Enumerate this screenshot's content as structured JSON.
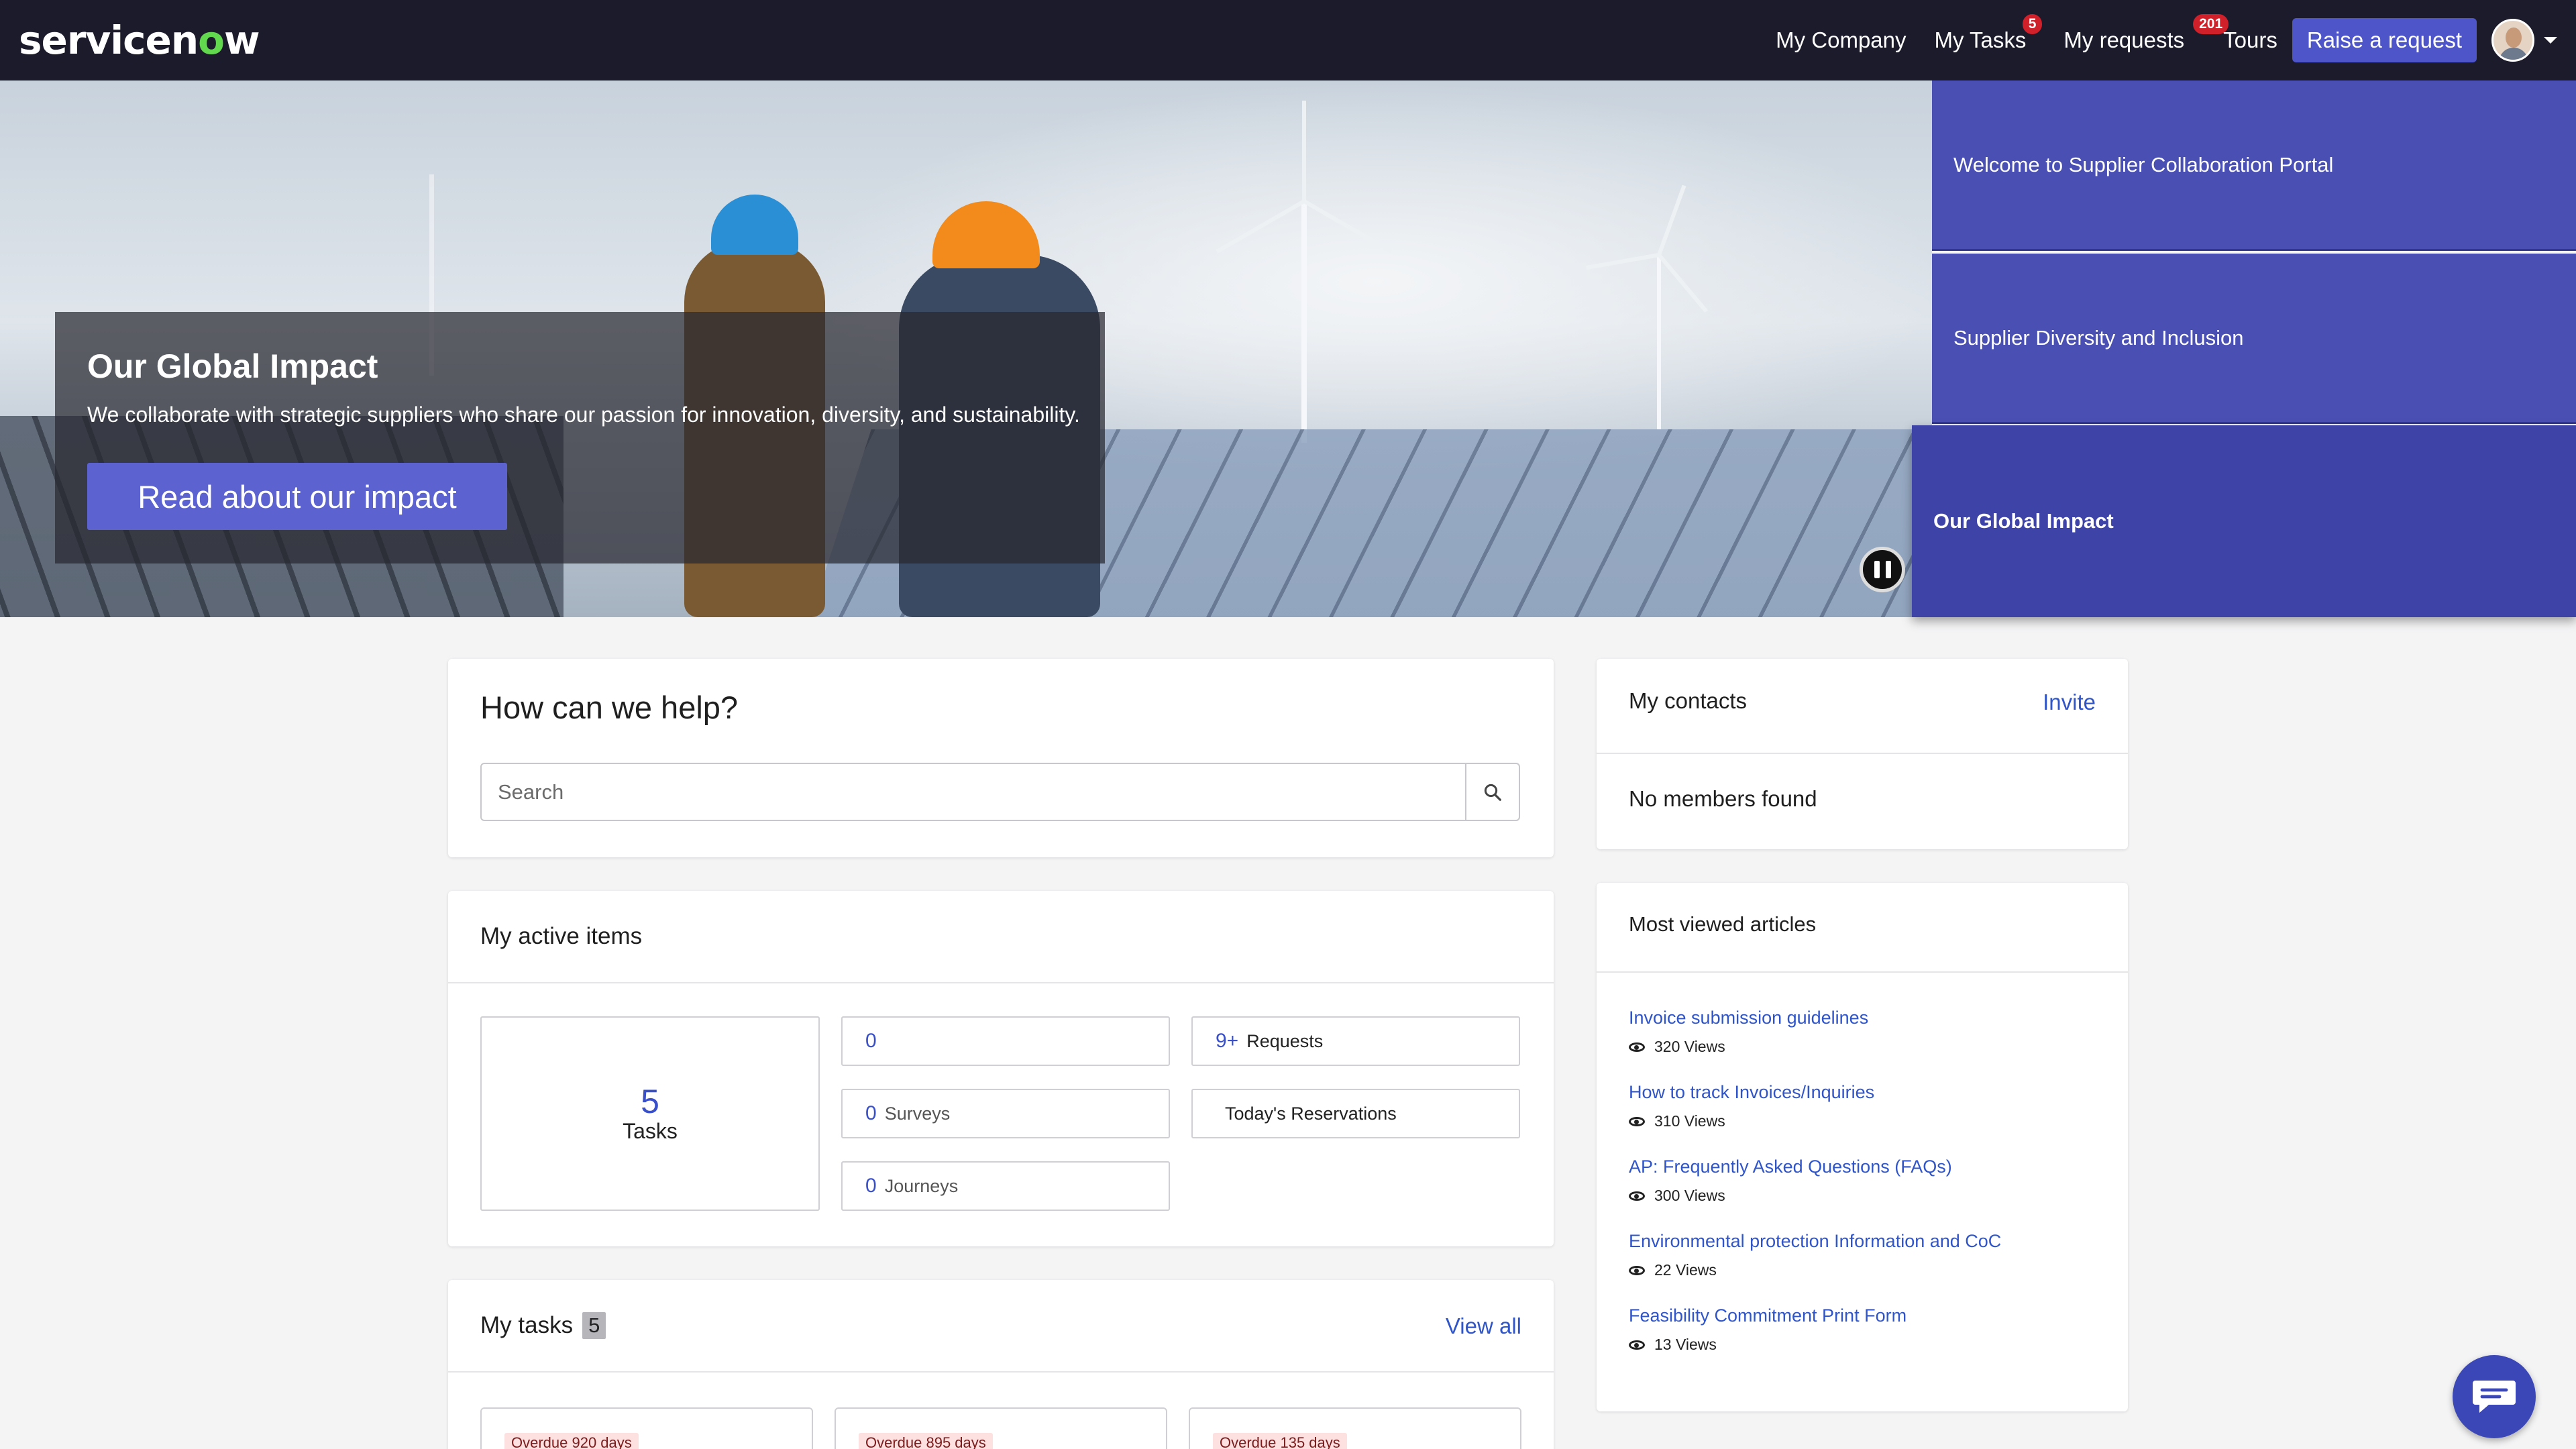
{
  "brand": {
    "logo_main": "servicen",
    "logo_o": "o",
    "logo_end": "w"
  },
  "nav": {
    "my_company": "My Company",
    "my_tasks": "My Tasks",
    "my_tasks_badge": "5",
    "my_requests": "My requests",
    "my_requests_badge": "201",
    "tours": "Tours",
    "raise_request": "Raise a request"
  },
  "hero": {
    "title": "Our Global Impact",
    "text": "We collaborate with strategic suppliers who share our passion for innovation, diversity, and sustainability.",
    "button": "Read about our impact"
  },
  "slides": [
    {
      "label": "Welcome to Supplier Collaboration Portal"
    },
    {
      "label": "Supplier Diversity and Inclusion"
    },
    {
      "label": "Our Global Impact"
    }
  ],
  "help": {
    "title": "How can we help?",
    "search_placeholder": "Search"
  },
  "active_items": {
    "title": "My active items",
    "tasks_count": "5",
    "tasks_label": "Tasks",
    "approvals_count": "0",
    "requests_count": "9+",
    "requests_label": "Requests",
    "surveys_count": "0",
    "surveys_label": "Surveys",
    "reservations_label": "Today's Reservations",
    "journeys_count": "0",
    "journeys_label": "Journeys"
  },
  "my_tasks": {
    "title": "My tasks",
    "count": "5",
    "view_all": "View all",
    "items": [
      {
        "overdue": "Overdue 920 days"
      },
      {
        "overdue": "Overdue 895 days"
      },
      {
        "overdue": "Overdue 135 days"
      }
    ]
  },
  "contacts": {
    "title": "My contacts",
    "invite": "Invite",
    "empty": "No members found"
  },
  "articles": {
    "title": "Most viewed articles",
    "items": [
      {
        "title": "Invoice submission guidelines",
        "views": "320 Views"
      },
      {
        "title": "How to track Invoices/Inquiries",
        "views": "310 Views"
      },
      {
        "title": "AP: Frequently Asked Questions (FAQs)",
        "views": "300 Views"
      },
      {
        "title": "Environmental protection Information and CoC",
        "views": "22 Views"
      },
      {
        "title": "Feasibility Commitment Print Form",
        "views": "13 Views"
      }
    ]
  },
  "colors": {
    "nav_bg": "#1c1b2b",
    "accent": "#4d55c9",
    "slide_bg": "#4a4fb3",
    "link": "#2f55c8",
    "badge": "#d0202a"
  }
}
